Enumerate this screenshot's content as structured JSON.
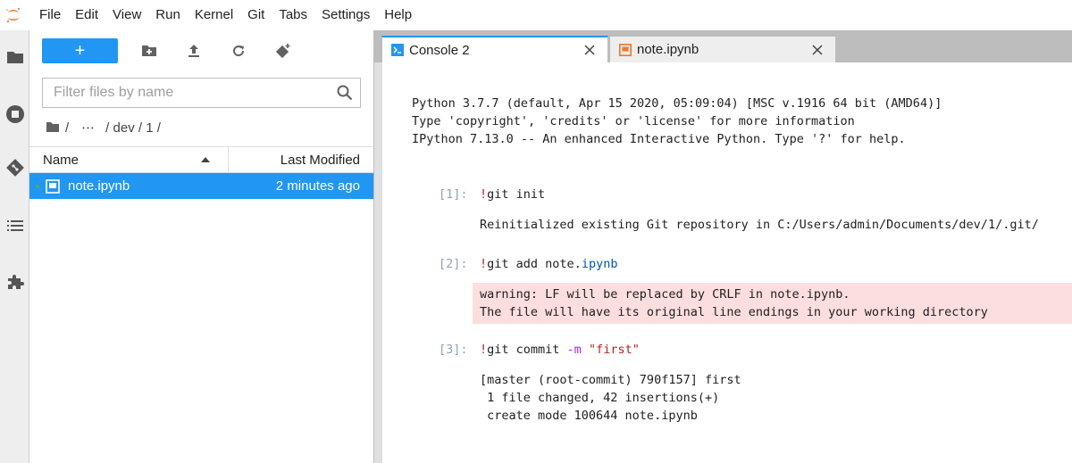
{
  "menu": [
    "File",
    "Edit",
    "View",
    "Run",
    "Kernel",
    "Git",
    "Tabs",
    "Settings",
    "Help"
  ],
  "colors": {
    "accent": "#2196f3",
    "logo": "#f37726",
    "stderr_bg": "#fddede"
  },
  "filebrowser": {
    "new_label": "+",
    "filter_placeholder": "Filter files by name",
    "breadcrumb": {
      "sep": "/",
      "ellipsis": "⋯",
      "path": "/ dev / 1 /"
    },
    "columns": {
      "name": "Name",
      "modified": "Last Modified"
    },
    "files": [
      {
        "name": "note.ipynb",
        "modified": "2 minutes ago"
      }
    ]
  },
  "tabs": [
    {
      "label": "Console 2",
      "icon": "console-icon"
    },
    {
      "label": "note.ipynb",
      "icon": "notebook-icon"
    }
  ],
  "console": {
    "banner": [
      "Python 3.7.7 (default, Apr 15 2020, 05:09:04) [MSC v.1916 64 bit (AMD64)]",
      "Type 'copyright', 'credits' or 'license' for more information",
      "IPython 7.13.0 -- An enhanced Interactive Python. Type '?' for help."
    ],
    "cells": [
      {
        "prompt": "[1]:",
        "bang": "!",
        "cmd": "git init",
        "output": "Reinitialized existing Git repository in C:/Users/admin/Documents/dev/1/.git/"
      },
      {
        "prompt": "[2]:",
        "bang": "!",
        "cmd": "git add note.",
        "cmd_ext": "ipynb",
        "stderr": [
          "warning: LF will be replaced by CRLF in note.ipynb.",
          "The file will have its original line endings in your working directory"
        ]
      },
      {
        "prompt": "[3]:",
        "bang": "!",
        "cmd": "git commit ",
        "flag": "-m",
        "arg": "\"first\"",
        "output_lines": [
          "[master (root-commit) 790f157] first",
          " 1 file changed, 42 insertions(+)",
          " create mode 100644 note.ipynb"
        ]
      }
    ]
  }
}
